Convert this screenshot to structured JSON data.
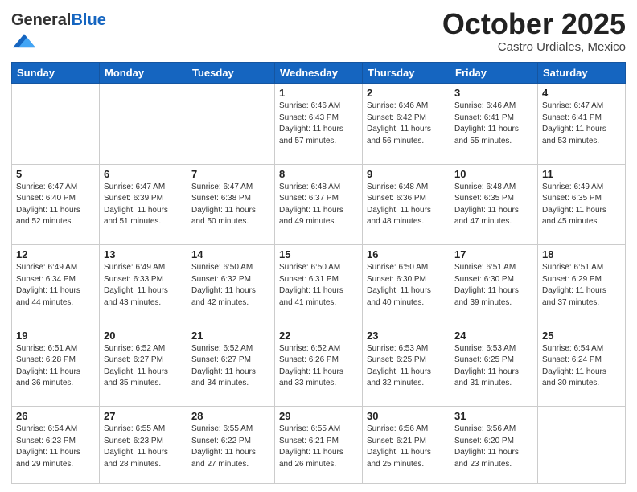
{
  "header": {
    "logo_general": "General",
    "logo_blue": "Blue",
    "month": "October 2025",
    "location": "Castro Urdiales, Mexico"
  },
  "days_of_week": [
    "Sunday",
    "Monday",
    "Tuesday",
    "Wednesday",
    "Thursday",
    "Friday",
    "Saturday"
  ],
  "weeks": [
    [
      {
        "num": "",
        "info": ""
      },
      {
        "num": "",
        "info": ""
      },
      {
        "num": "",
        "info": ""
      },
      {
        "num": "1",
        "info": "Sunrise: 6:46 AM\nSunset: 6:43 PM\nDaylight: 11 hours\nand 57 minutes."
      },
      {
        "num": "2",
        "info": "Sunrise: 6:46 AM\nSunset: 6:42 PM\nDaylight: 11 hours\nand 56 minutes."
      },
      {
        "num": "3",
        "info": "Sunrise: 6:46 AM\nSunset: 6:41 PM\nDaylight: 11 hours\nand 55 minutes."
      },
      {
        "num": "4",
        "info": "Sunrise: 6:47 AM\nSunset: 6:41 PM\nDaylight: 11 hours\nand 53 minutes."
      }
    ],
    [
      {
        "num": "5",
        "info": "Sunrise: 6:47 AM\nSunset: 6:40 PM\nDaylight: 11 hours\nand 52 minutes."
      },
      {
        "num": "6",
        "info": "Sunrise: 6:47 AM\nSunset: 6:39 PM\nDaylight: 11 hours\nand 51 minutes."
      },
      {
        "num": "7",
        "info": "Sunrise: 6:47 AM\nSunset: 6:38 PM\nDaylight: 11 hours\nand 50 minutes."
      },
      {
        "num": "8",
        "info": "Sunrise: 6:48 AM\nSunset: 6:37 PM\nDaylight: 11 hours\nand 49 minutes."
      },
      {
        "num": "9",
        "info": "Sunrise: 6:48 AM\nSunset: 6:36 PM\nDaylight: 11 hours\nand 48 minutes."
      },
      {
        "num": "10",
        "info": "Sunrise: 6:48 AM\nSunset: 6:35 PM\nDaylight: 11 hours\nand 47 minutes."
      },
      {
        "num": "11",
        "info": "Sunrise: 6:49 AM\nSunset: 6:35 PM\nDaylight: 11 hours\nand 45 minutes."
      }
    ],
    [
      {
        "num": "12",
        "info": "Sunrise: 6:49 AM\nSunset: 6:34 PM\nDaylight: 11 hours\nand 44 minutes."
      },
      {
        "num": "13",
        "info": "Sunrise: 6:49 AM\nSunset: 6:33 PM\nDaylight: 11 hours\nand 43 minutes."
      },
      {
        "num": "14",
        "info": "Sunrise: 6:50 AM\nSunset: 6:32 PM\nDaylight: 11 hours\nand 42 minutes."
      },
      {
        "num": "15",
        "info": "Sunrise: 6:50 AM\nSunset: 6:31 PM\nDaylight: 11 hours\nand 41 minutes."
      },
      {
        "num": "16",
        "info": "Sunrise: 6:50 AM\nSunset: 6:30 PM\nDaylight: 11 hours\nand 40 minutes."
      },
      {
        "num": "17",
        "info": "Sunrise: 6:51 AM\nSunset: 6:30 PM\nDaylight: 11 hours\nand 39 minutes."
      },
      {
        "num": "18",
        "info": "Sunrise: 6:51 AM\nSunset: 6:29 PM\nDaylight: 11 hours\nand 37 minutes."
      }
    ],
    [
      {
        "num": "19",
        "info": "Sunrise: 6:51 AM\nSunset: 6:28 PM\nDaylight: 11 hours\nand 36 minutes."
      },
      {
        "num": "20",
        "info": "Sunrise: 6:52 AM\nSunset: 6:27 PM\nDaylight: 11 hours\nand 35 minutes."
      },
      {
        "num": "21",
        "info": "Sunrise: 6:52 AM\nSunset: 6:27 PM\nDaylight: 11 hours\nand 34 minutes."
      },
      {
        "num": "22",
        "info": "Sunrise: 6:52 AM\nSunset: 6:26 PM\nDaylight: 11 hours\nand 33 minutes."
      },
      {
        "num": "23",
        "info": "Sunrise: 6:53 AM\nSunset: 6:25 PM\nDaylight: 11 hours\nand 32 minutes."
      },
      {
        "num": "24",
        "info": "Sunrise: 6:53 AM\nSunset: 6:25 PM\nDaylight: 11 hours\nand 31 minutes."
      },
      {
        "num": "25",
        "info": "Sunrise: 6:54 AM\nSunset: 6:24 PM\nDaylight: 11 hours\nand 30 minutes."
      }
    ],
    [
      {
        "num": "26",
        "info": "Sunrise: 6:54 AM\nSunset: 6:23 PM\nDaylight: 11 hours\nand 29 minutes."
      },
      {
        "num": "27",
        "info": "Sunrise: 6:55 AM\nSunset: 6:23 PM\nDaylight: 11 hours\nand 28 minutes."
      },
      {
        "num": "28",
        "info": "Sunrise: 6:55 AM\nSunset: 6:22 PM\nDaylight: 11 hours\nand 27 minutes."
      },
      {
        "num": "29",
        "info": "Sunrise: 6:55 AM\nSunset: 6:21 PM\nDaylight: 11 hours\nand 26 minutes."
      },
      {
        "num": "30",
        "info": "Sunrise: 6:56 AM\nSunset: 6:21 PM\nDaylight: 11 hours\nand 25 minutes."
      },
      {
        "num": "31",
        "info": "Sunrise: 6:56 AM\nSunset: 6:20 PM\nDaylight: 11 hours\nand 23 minutes."
      },
      {
        "num": "",
        "info": ""
      }
    ]
  ]
}
